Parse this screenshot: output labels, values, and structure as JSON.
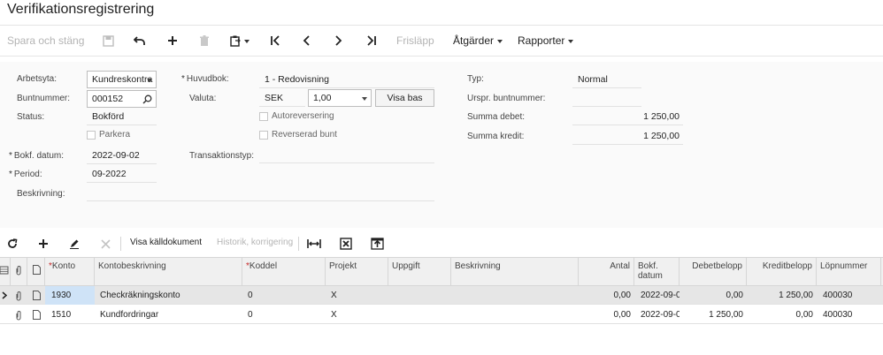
{
  "page": {
    "title": "Verifikationsregistrering"
  },
  "toolbar": {
    "save_close": "Spara och stäng",
    "release": "Frisläpp",
    "actions": "Åtgärder",
    "reports": "Rapporter"
  },
  "form": {
    "workspace": {
      "label": "Arbetsyta:",
      "value": "Kundreskontra"
    },
    "batch_number": {
      "label": "Buntnummer:",
      "value": "000152"
    },
    "status": {
      "label": "Status:",
      "value": "Bokförd"
    },
    "park": {
      "label": "Parkera"
    },
    "posting_date": {
      "required": "*",
      "label": "Bokf. datum:",
      "value": "2022-09-02"
    },
    "period": {
      "required": "*",
      "label": "Period:",
      "value": "09-2022"
    },
    "description": {
      "label": "Beskrivning:",
      "value": ""
    },
    "ledger": {
      "required": "*",
      "label": "Huvudbok:",
      "value": "1 - Redovisning"
    },
    "currency": {
      "label": "Valuta:",
      "value": "SEK",
      "rate": "1,00",
      "show_base": "Visa bas"
    },
    "auto_reversing": {
      "label": "Autoreversering"
    },
    "reversed_batch": {
      "label": "Reverserad bunt"
    },
    "transaction_type": {
      "label": "Transaktionstyp:",
      "value": ""
    },
    "type": {
      "label": "Typ:",
      "value": "Normal"
    },
    "orig_batch": {
      "label": "Urspr. buntnummer:",
      "value": ""
    },
    "sum_debit": {
      "label": "Summa debet:",
      "value": "1 250,00"
    },
    "sum_credit": {
      "label": "Summa kredit:",
      "value": "1 250,00"
    }
  },
  "grid_toolbar": {
    "show_source": "Visa källdokument",
    "history": "Historik, korrigering"
  },
  "grid": {
    "headers": {
      "account": "Konto",
      "account_desc": "Kontobeskrivning",
      "subaccount": "Koddel",
      "project": "Projekt",
      "task": "Uppgift",
      "description": "Beskrivning",
      "qty": "Antal",
      "posting_date": "Bokf. datum",
      "debit": "Debetbelopp",
      "credit": "Kreditbelopp",
      "line_no": "Löpnummer"
    },
    "rows": [
      {
        "account": "1930",
        "account_desc": "Checkräkningskonto",
        "subaccount": "0",
        "project": "X",
        "task": "",
        "description": "",
        "qty": "0,00",
        "posting_date": "2022-09-0",
        "debit": "0,00",
        "credit": "1 250,00",
        "line_no": "400030"
      },
      {
        "account": "1510",
        "account_desc": "Kundfordringar",
        "subaccount": "0",
        "project": "X",
        "task": "",
        "description": "",
        "qty": "0,00",
        "posting_date": "2022-09-0",
        "debit": "1 250,00",
        "credit": "0,00",
        "line_no": "400030"
      }
    ]
  },
  "colors": {
    "accent_required": "#c62828",
    "selected_row": "#e6e6e6",
    "active_cell": "#cfe3f7"
  }
}
